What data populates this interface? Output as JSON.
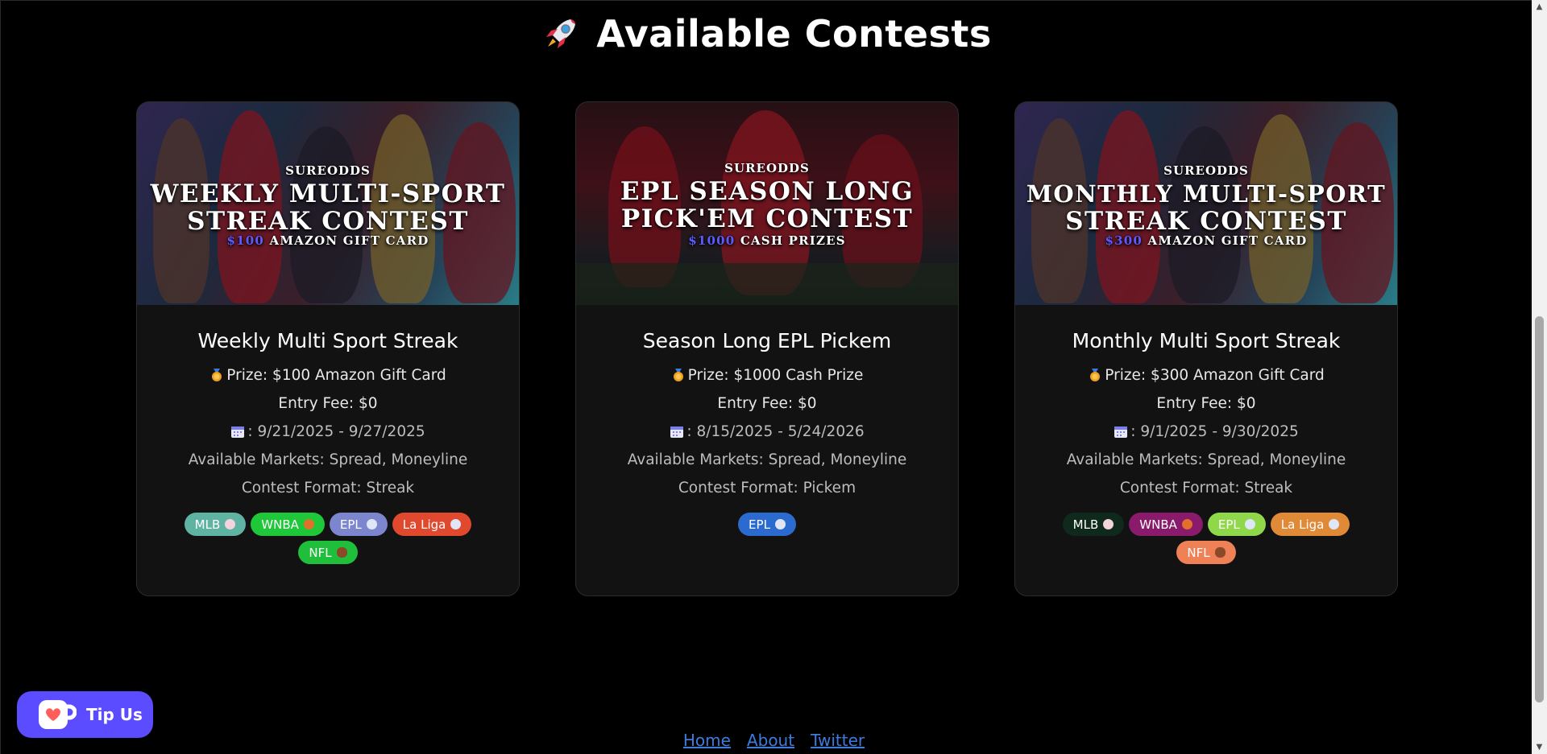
{
  "heading": {
    "title": "Available Contests",
    "icon": "rocket-icon"
  },
  "contests": [
    {
      "banner": {
        "brand": "SUREODDS",
        "title_line1": "WEEKLY MULTI-SPORT",
        "title_line2": "STREAK CONTEST",
        "prize_amount": "$100",
        "prize_rest": "AMAZON GIFT CARD"
      },
      "title": "Weekly Multi Sport Streak",
      "prize": "Prize: $100 Amazon Gift Card",
      "entry_fee": "Entry Fee: $0",
      "dates": ": 9/21/2025 - 9/27/2025",
      "markets": "Available Markets: Spread, Moneyline",
      "format": "Contest Format: Streak",
      "tags": [
        {
          "label": "MLB",
          "color": "#5fb3a3",
          "ball": "#f3d3dc"
        },
        {
          "label": "WNBA",
          "color": "#1ec838",
          "ball": "#e0702a"
        },
        {
          "label": "EPL",
          "color": "#7b86cf",
          "ball": "#dfe6f5"
        },
        {
          "label": "La Liga",
          "color": "#e0492d",
          "ball": "#dfe6f5"
        },
        {
          "label": "NFL",
          "color": "#1fbf3c",
          "ball": "#8a4a2a"
        }
      ]
    },
    {
      "banner": {
        "brand": "SUREODDS",
        "title_line1": "EPL SEASON LONG",
        "title_line2": "PICK'EM CONTEST",
        "prize_amount": "$1000",
        "prize_rest": "CASH PRIZES"
      },
      "title": "Season Long EPL Pickem",
      "prize": "Prize: $1000 Cash Prize",
      "entry_fee": "Entry Fee: $0",
      "dates": ": 8/15/2025 - 5/24/2026",
      "markets": "Available Markets: Spread, Moneyline",
      "format": "Contest Format: Pickem",
      "tags": [
        {
          "label": "EPL",
          "color": "#2b6bd0",
          "ball": "#dfe6f5"
        }
      ]
    },
    {
      "banner": {
        "brand": "SUREODDS",
        "title_line1": "MONTHLY MULTI-SPORT",
        "title_line2": "STREAK CONTEST",
        "prize_amount": "$300",
        "prize_rest": "AMAZON GIFT CARD"
      },
      "title": "Monthly Multi Sport Streak",
      "prize": "Prize: $300 Amazon Gift Card",
      "entry_fee": "Entry Fee: $0",
      "dates": ": 9/1/2025 - 9/30/2025",
      "markets": "Available Markets: Spread, Moneyline",
      "format": "Contest Format: Streak",
      "tags": [
        {
          "label": "MLB",
          "color": "#0f2a1c",
          "ball": "#f3d3dc"
        },
        {
          "label": "WNBA",
          "color": "#8a1a6c",
          "ball": "#e0702a"
        },
        {
          "label": "EPL",
          "color": "#8ed84a",
          "ball": "#dfe6f5"
        },
        {
          "label": "La Liga",
          "color": "#e08a38",
          "ball": "#dfe6f5"
        },
        {
          "label": "NFL",
          "color": "#ef8157",
          "ball": "#8a4a2a"
        }
      ]
    }
  ],
  "tip_button": {
    "label": "Tip Us",
    "icon": "kofi-cup-icon",
    "color": "#5b4cff"
  },
  "footer": {
    "links": [
      "Home",
      "About",
      "Twitter"
    ],
    "link_color": "#3d7bdc"
  }
}
